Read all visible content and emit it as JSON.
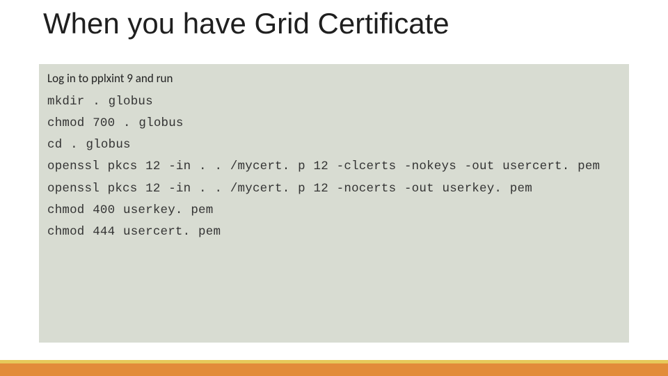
{
  "slide": {
    "title": "When you have Grid Certificate",
    "intro": "Log in to pplxint 9 and run",
    "commands": [
      "mkdir . globus",
      "chmod 700 . globus",
      "cd . globus",
      "openssl pkcs 12 -in . . /mycert. p 12 -clcerts -nokeys -out usercert. pem",
      "openssl pkcs 12 -in . . /mycert. p 12 -nocerts -out userkey. pem",
      "chmod 400 userkey. pem",
      "chmod 444 usercert. pem"
    ]
  }
}
